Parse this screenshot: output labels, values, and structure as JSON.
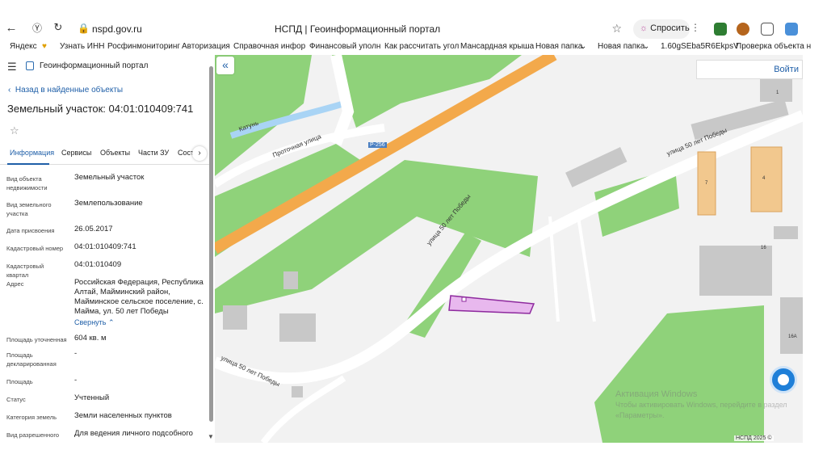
{
  "browser": {
    "url": "nspd.gov.ru",
    "tab_title": "НСПД | Геоинформационный портал",
    "ask_button": "Спросить",
    "bookmarks": [
      "Яндекс",
      "Узнать ИНН",
      "Росфинмониторинг",
      "Авторизация",
      "Справочная инфор",
      "Финансовый уполн",
      "Как рассчитать угол",
      "Мансардная крыша",
      "Новая папка",
      "Новая папка",
      "1.60gSEba5R6EkpsV",
      "Проверка объекта н"
    ]
  },
  "sidebar": {
    "portal_name": "Геоинформационный портал",
    "back_link": "Назад в найденные объекты",
    "title": "Земельный участок: 04:01:010409:741",
    "tabs": [
      "Информация",
      "Сервисы",
      "Объекты",
      "Части ЗУ",
      "Сост"
    ],
    "properties": [
      {
        "label": "Вид объекта недвижимости",
        "value": "Земельный участок"
      },
      {
        "label": "Вид земельного участка",
        "value": "Землепользование"
      },
      {
        "label": "Дата присвоения",
        "value": "26.05.2017"
      },
      {
        "label": "Кадастровый номер",
        "value": "04:01:010409:741"
      },
      {
        "label": "Кадастровый квартал",
        "value": "04:01:010409"
      },
      {
        "label": "Адрес",
        "value": "Российская Федерация, Республика Алтай, Майминский район, Майминское сельское поселение, с. Майма, ул. 50 лет Победы"
      },
      {
        "label": "Площадь уточненная",
        "value": "604 кв. м"
      },
      {
        "label": "Площадь декларированная",
        "value": "-"
      },
      {
        "label": "Площадь",
        "value": "-"
      },
      {
        "label": "Статус",
        "value": "Учтенный"
      },
      {
        "label": "Категория земель",
        "value": "Земли населенных пунктов"
      },
      {
        "label": "Вид разрешенного",
        "value": "Для ведения личного подсобного"
      }
    ],
    "collapse_link": "Свернуть"
  },
  "map": {
    "login_button": "Войти",
    "labels": {
      "river": "Катунь",
      "street_protochnaya": "Проточная улица",
      "road_badge": "Р-256",
      "street_50_1": "улица 50 лет Победы",
      "street_50_2": "улица 50 лет Победы",
      "street_50_3": "улица 50 лет Победы",
      "house_1": "1",
      "house_7": "7",
      "house_4": "4",
      "house_16": "16",
      "house_16a": "16А"
    },
    "copyright": "НСПД 2025 ©",
    "activate_line1": "Активация Windows",
    "activate_line2": "Чтобы активировать Windows, перейдите в раздел",
    "activate_line3": "«Параметры».",
    "colors": {
      "parcel_fill": "#e8b8ee",
      "parcel_stroke": "#8e2a9e",
      "green": "#8fd27a",
      "highway": "#f3a94b",
      "building": "#c8c8c8",
      "building_orange": "#f2c88e"
    }
  }
}
